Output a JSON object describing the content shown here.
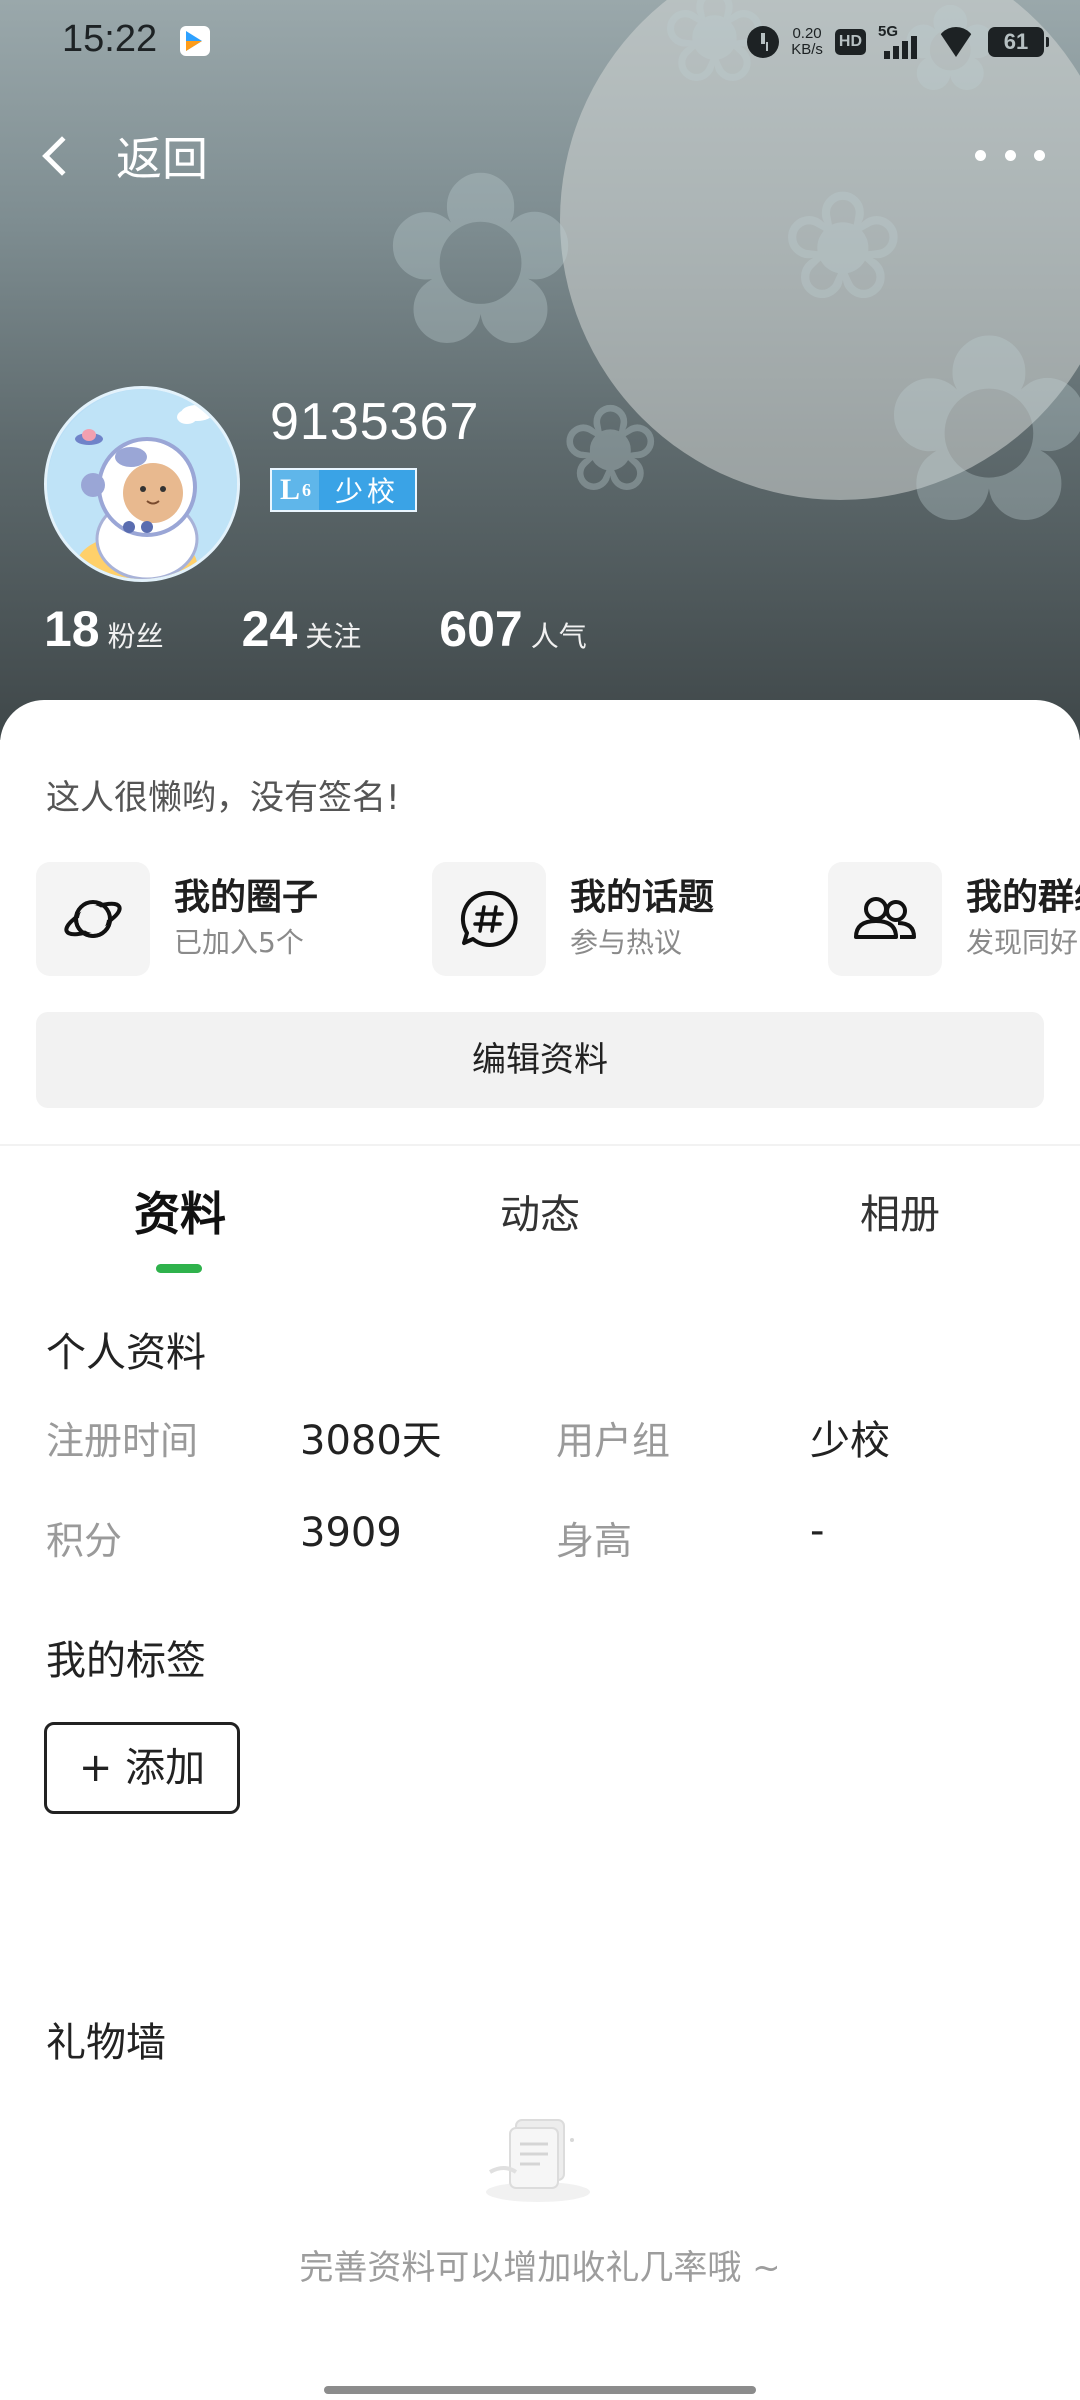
{
  "status_bar": {
    "time": "15:22",
    "net_speed_value": "0.20",
    "net_speed_unit": "KB/s",
    "hd": "HD",
    "network": "5G",
    "battery": "61"
  },
  "nav": {
    "back_label": "返回"
  },
  "profile": {
    "username": "9135367",
    "level_code": "L",
    "level_num": "6",
    "rank": "少校",
    "stats": [
      {
        "value": "18",
        "label": "粉丝"
      },
      {
        "value": "24",
        "label": "关注"
      },
      {
        "value": "607",
        "label": "人气"
      }
    ],
    "signature": "这人很懒哟，没有签名!"
  },
  "quick_links": [
    {
      "title": "我的圈子",
      "subtitle": "已加入5个",
      "icon": "planet-icon"
    },
    {
      "title": "我的话题",
      "subtitle": "参与热议",
      "icon": "hashtag-bubble-icon"
    },
    {
      "title": "我的群组",
      "subtitle": "发现同好",
      "icon": "group-people-icon"
    }
  ],
  "edit_profile_label": "编辑资料",
  "tabs": [
    {
      "label": "资料",
      "active": true
    },
    {
      "label": "动态",
      "active": false
    },
    {
      "label": "相册",
      "active": false
    }
  ],
  "personal_info": {
    "title": "个人资料",
    "rows": [
      [
        {
          "label": "注册时间",
          "value": "3080天"
        },
        {
          "label": "用户组",
          "value": "少校"
        }
      ],
      [
        {
          "label": "积分",
          "value": "3909"
        },
        {
          "label": "身高",
          "value": "-"
        }
      ]
    ]
  },
  "tags": {
    "title": "我的标签",
    "add_label": "+ 添加"
  },
  "gift_wall": {
    "title": "礼物墙",
    "empty_hint": "完善资料可以增加收礼几率哦 ~"
  },
  "colors": {
    "accent_green": "#2fb24c",
    "badge_blue": "#3aa3e6"
  }
}
